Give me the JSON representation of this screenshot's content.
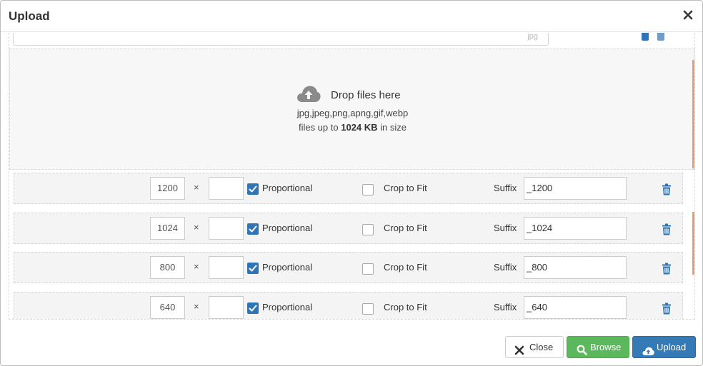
{
  "dialog": {
    "title": "Upload"
  },
  "file_row": {
    "extension_hint": "jpg"
  },
  "dropzone": {
    "title": "Drop files here",
    "types": "jpg,jpeg,png,apng,gif,webp",
    "size_prefix": "files up to",
    "size_value": "1024 KB",
    "size_suffix": "in size"
  },
  "size_rows": [
    {
      "width": "1200",
      "height": "",
      "proportional_label": "Proportional",
      "proportional": true,
      "crop_label": "Crop to Fit",
      "crop": false,
      "suffix_label": "Suffix",
      "suffix": "_1200"
    },
    {
      "width": "1024",
      "height": "",
      "proportional_label": "Proportional",
      "proportional": true,
      "crop_label": "Crop to Fit",
      "crop": false,
      "suffix_label": "Suffix",
      "suffix": "_1024"
    },
    {
      "width": "800",
      "height": "",
      "proportional_label": "Proportional",
      "proportional": true,
      "crop_label": "Crop to Fit",
      "crop": false,
      "suffix_label": "Suffix",
      "suffix": "_800"
    },
    {
      "width": "640",
      "height": "",
      "proportional_label": "Proportional",
      "proportional": true,
      "crop_label": "Crop to Fit",
      "crop": false,
      "suffix_label": "Suffix",
      "suffix": "_640"
    }
  ],
  "times_symbol": "×",
  "footer": {
    "close_label": "Close",
    "browse_label": "Browse",
    "upload_label": "Upload"
  },
  "colors": {
    "primary": "#337ab7",
    "success": "#5cb85c",
    "checkbox": "#2f74b5",
    "scroll_accent": "#ee9b6e"
  }
}
